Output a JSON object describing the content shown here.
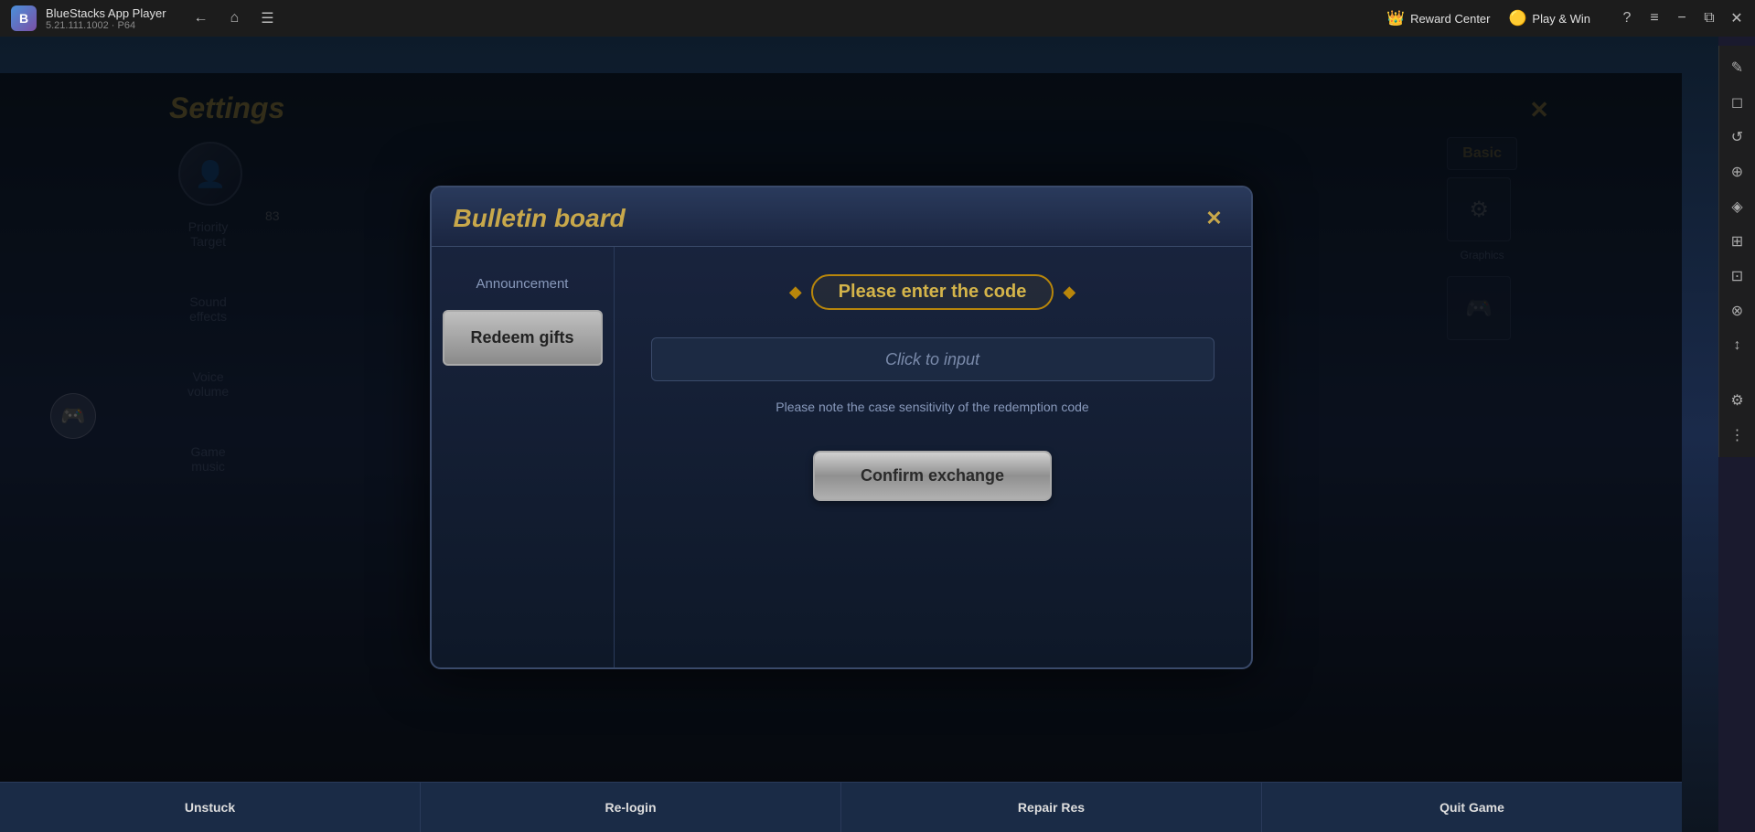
{
  "titlebar": {
    "app_name": "BlueStacks App Player",
    "version": "5.21.111.1002 · P64",
    "reward_center": "Reward Center",
    "play_win": "Play & Win",
    "nav": {
      "back": "←",
      "home": "⌂",
      "bookmark": "☰"
    },
    "window_btns": {
      "help": "?",
      "menu": "≡",
      "minimize": "−",
      "restore": "⧉",
      "close": "✕"
    }
  },
  "toolbar": {
    "icons": [
      "✎",
      "◻",
      "↺",
      "⊕",
      "◈",
      "⊞",
      "⊡",
      "⊗",
      "↕",
      "⋮"
    ]
  },
  "bulletin": {
    "title": "Bulletin board",
    "close_label": "✕",
    "sidebar": {
      "announcement_label": "Announcement",
      "redeem_label": "Redeem gifts"
    },
    "content": {
      "code_title": "Please enter the code",
      "input_placeholder": "Click to input",
      "notice_text": "Please note the case sensitivity of the redemption code",
      "confirm_label": "Confirm exchange"
    }
  },
  "background": {
    "settings_title": "Settings",
    "close_x": "✕",
    "sidebar_items": [
      "Priority\nTarget",
      "Sound\neffects",
      "Voice\nvolume",
      "Game\nmusic"
    ],
    "right_items": [
      "Basic"
    ],
    "char_level": "83"
  },
  "bottom_bar": {
    "buttons": [
      "Unstuck",
      "Re-login",
      "Repair Res",
      "Quit Game"
    ]
  }
}
